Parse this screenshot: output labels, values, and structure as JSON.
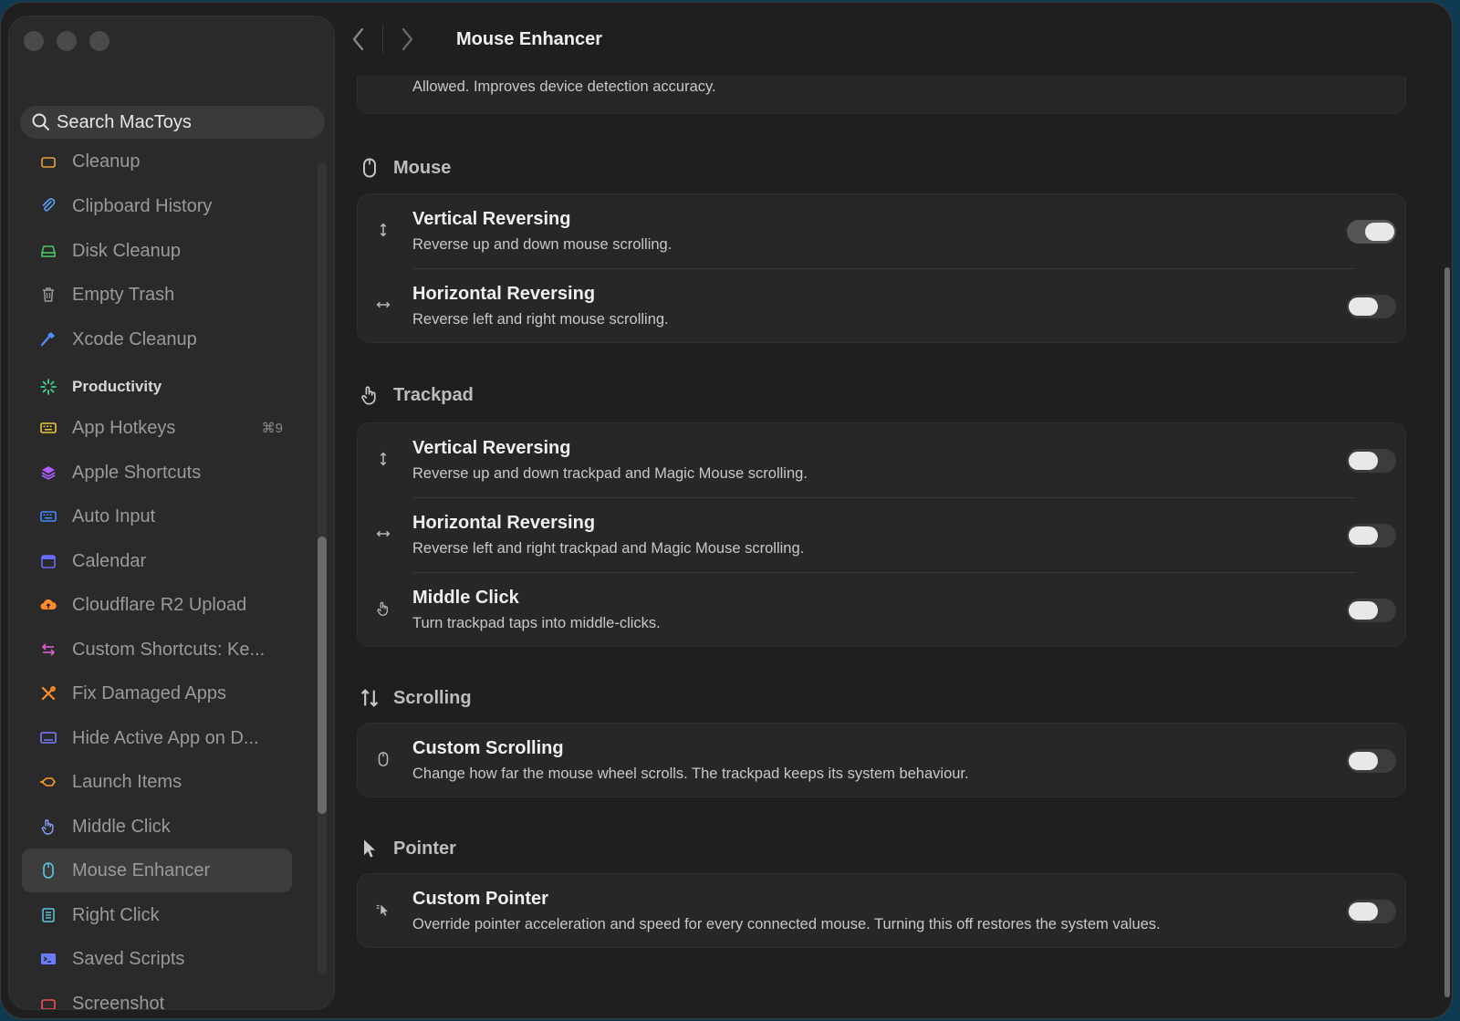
{
  "window": {
    "title": "Mouse Enhancer"
  },
  "search": {
    "placeholder": "Search MacToys"
  },
  "sidebar": {
    "items": [
      {
        "label": "Cleanup",
        "icon": "cleanup-icon",
        "color": "#e6a13b",
        "type": "section-partial"
      },
      {
        "label": "Clipboard History",
        "icon": "paperclip-icon",
        "color": "#5aa0ff"
      },
      {
        "label": "Disk Cleanup",
        "icon": "disk-icon",
        "color": "#4cc76a"
      },
      {
        "label": "Empty Trash",
        "icon": "trash-icon",
        "color": "#9a9a9a"
      },
      {
        "label": "Xcode Cleanup",
        "icon": "hammer-icon",
        "color": "#4f8fff"
      },
      {
        "label": "Productivity",
        "icon": "sparkle-icon",
        "color": "#3dd68c",
        "type": "section"
      },
      {
        "label": "App Hotkeys",
        "icon": "keyboard-icon",
        "color": "#e8c838",
        "shortcut": "⌘9"
      },
      {
        "label": "Apple Shortcuts",
        "icon": "layers-icon",
        "color": "#b05cff"
      },
      {
        "label": "Auto Input",
        "icon": "keyboard-icon",
        "color": "#3d8cff"
      },
      {
        "label": "Calendar",
        "icon": "calendar-icon",
        "color": "#6b6bff"
      },
      {
        "label": "Cloudflare R2 Upload",
        "icon": "cloud-upload-icon",
        "color": "#ff8a2a"
      },
      {
        "label": "Custom Shortcuts: Ke...",
        "icon": "arrows-icon",
        "color": "#e05ccf"
      },
      {
        "label": "Fix Damaged Apps",
        "icon": "tools-icon",
        "color": "#ff8a2a"
      },
      {
        "label": "Hide Active App on D...",
        "icon": "display-icon",
        "color": "#7a7aff"
      },
      {
        "label": "Launch Items",
        "icon": "launch-icon",
        "color": "#ff9a2a"
      },
      {
        "label": "Middle Click",
        "icon": "hand-icon",
        "color": "#8aa0ff"
      },
      {
        "label": "Mouse Enhancer",
        "icon": "mouse-icon",
        "color": "#5ec8e0",
        "selected": true
      },
      {
        "label": "Right Click",
        "icon": "list-icon",
        "color": "#5ec8e0"
      },
      {
        "label": "Saved Scripts",
        "icon": "terminal-icon",
        "color": "#6b7bff"
      },
      {
        "label": "Screenshot",
        "icon": "camera-icon",
        "color": "#ff4a5a",
        "type": "partial"
      }
    ]
  },
  "content": {
    "top_partial": "Allowed. Improves device detection accuracy.",
    "sections": [
      {
        "title": "Mouse",
        "icon": "mouse-icon",
        "rows": [
          {
            "title": "Vertical Reversing",
            "desc": "Reverse up and down mouse scrolling.",
            "icon": "vertical-arrows-icon",
            "on": true
          },
          {
            "title": "Horizontal Reversing",
            "desc": "Reverse left and right mouse scrolling.",
            "icon": "horizontal-arrows-icon",
            "on": false
          }
        ]
      },
      {
        "title": "Trackpad",
        "icon": "hand-tap-icon",
        "rows": [
          {
            "title": "Vertical Reversing",
            "desc": "Reverse up and down trackpad and Magic Mouse scrolling.",
            "icon": "vertical-arrows-icon",
            "on": false
          },
          {
            "title": "Horizontal Reversing",
            "desc": "Reverse left and right trackpad and Magic Mouse scrolling.",
            "icon": "horizontal-arrows-icon",
            "on": false
          },
          {
            "title": "Middle Click",
            "desc": "Turn trackpad taps into middle-clicks.",
            "icon": "hand-tap-icon",
            "on": false
          }
        ]
      },
      {
        "title": "Scrolling",
        "icon": "scroll-arrows-icon",
        "rows": [
          {
            "title": "Custom Scrolling",
            "desc": "Change how far the mouse wheel scrolls. The trackpad keeps its system behaviour.",
            "icon": "mouse-icon",
            "on": false
          }
        ]
      },
      {
        "title": "Pointer",
        "icon": "pointer-icon",
        "rows": [
          {
            "title": "Custom Pointer",
            "desc": "Override pointer acceleration and speed for every connected mouse. Turning this off restores the system values.",
            "icon": "pointer-motion-icon",
            "on": false
          }
        ]
      }
    ]
  }
}
